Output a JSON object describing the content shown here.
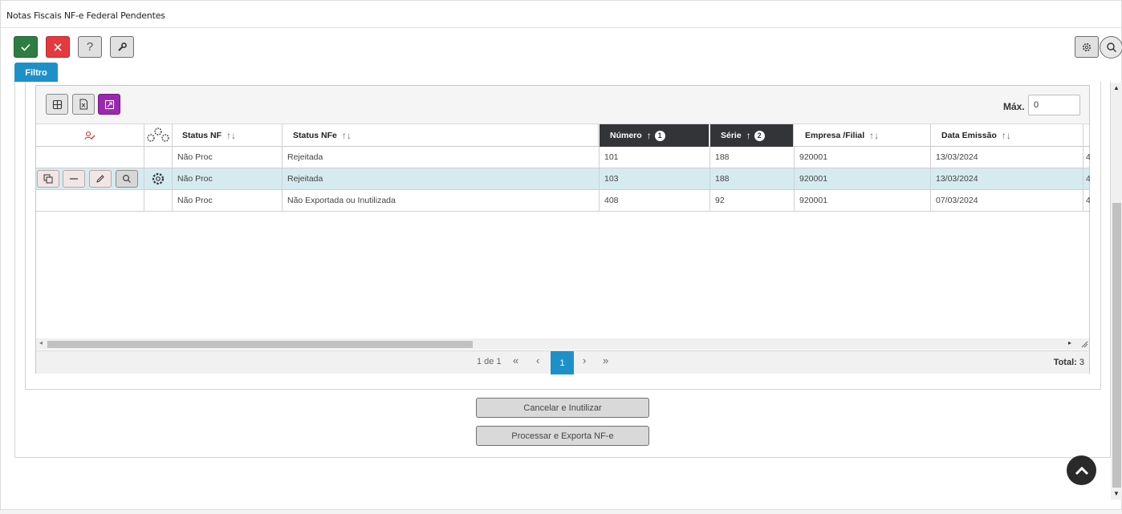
{
  "window": {
    "title": "Notas Fiscais NF-e Federal Pendentes"
  },
  "toolbar": {
    "confirm_icon": "check-icon",
    "cancel_icon": "close-icon",
    "help_label": "?",
    "tools_icon": "wrench-icon",
    "settings_icon": "gear-icon",
    "search_icon": "search-icon"
  },
  "filter_tab": {
    "label": "Filtro"
  },
  "grid": {
    "toolbar": {
      "max_label": "Máx.",
      "max_value": "0"
    },
    "columns": [
      {
        "label": "",
        "icon": "user-edit-icon"
      },
      {
        "label": "",
        "icon": "gears-icon"
      },
      {
        "label": "Status NF",
        "sort": "↑↓"
      },
      {
        "label": "Status NFe",
        "sort": "↑↓"
      },
      {
        "label": "Número",
        "sort": "↑",
        "order": "1"
      },
      {
        "label": "Série",
        "sort": "↑",
        "order": "2"
      },
      {
        "label": "Empresa /Filial",
        "sort": "↑↓"
      },
      {
        "label": "Data Emissão",
        "sort": "↑↓"
      }
    ],
    "rows": [
      {
        "status_nf": "Não Proc",
        "status_nfe": "Rejeitada",
        "numero": "101",
        "serie": "188",
        "empresa": "920001",
        "data": "13/03/2024",
        "extra": "4"
      },
      {
        "status_nf": "Não Proc",
        "status_nfe": "Rejeitada",
        "numero": "103",
        "serie": "188",
        "empresa": "920001",
        "data": "13/03/2024",
        "extra": "4"
      },
      {
        "status_nf": "Não Proc",
        "status_nfe": "Não Exportada ou Inutilizada",
        "numero": "408",
        "serie": "92",
        "empresa": "920001",
        "data": "07/03/2024",
        "extra": "4"
      }
    ],
    "pager": {
      "page_info": "1 de 1",
      "first": "«",
      "prev": "‹",
      "current": "1",
      "next": "›",
      "last": "»",
      "total_label": "Total:",
      "total_value": "3"
    }
  },
  "actions": {
    "cancel_label": "Cancelar e Inutilizar",
    "process_label": "Processar e Exporta NF-e"
  },
  "colors": {
    "accent": "#1e90c9",
    "confirm": "#2e7d43",
    "cancel": "#e3393f",
    "purple": "#9c27b0",
    "selected_row": "#d6ebf0",
    "header_dark": "#333438"
  }
}
